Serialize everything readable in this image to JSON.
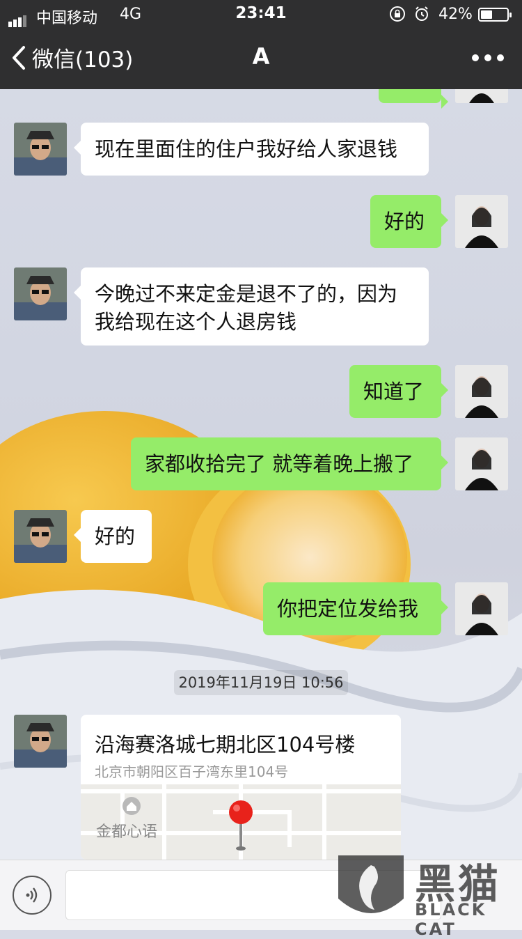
{
  "status_bar": {
    "carrier": "中国移动",
    "network": "4G",
    "time": "23:41",
    "battery_percent": "42%",
    "icons": [
      "signal-icon",
      "orientation-lock-icon",
      "alarm-icon",
      "battery-icon"
    ]
  },
  "nav": {
    "back_label": "微信(103)",
    "title": "A",
    "more_icon": "more-dots-icon"
  },
  "messages": [
    {
      "side": "left",
      "text": "现在里面住的住户我好给人家退钱"
    },
    {
      "side": "right",
      "text": "好的"
    },
    {
      "side": "left",
      "text_line1": "今晚过不来定金是退不了的，因为",
      "text_line2": "我给现在这个人退房钱"
    },
    {
      "side": "right",
      "text": "知道了"
    },
    {
      "side": "right",
      "text": "家都收拾完了 就等着晚上搬了"
    },
    {
      "side": "left",
      "text": "好的"
    },
    {
      "side": "right",
      "text": "你把定位发给我"
    }
  ],
  "timestamp": "2019年11月19日 10:56",
  "location": {
    "name": "沿海赛洛城七期北区104号楼",
    "address": "北京市朝阳区百子湾东里104号",
    "map_label": "金都心语",
    "icons": [
      "map-poi-icon",
      "map-pin-icon"
    ]
  },
  "input_bar": {
    "voice_icon": "voice-icon"
  },
  "watermark": {
    "text": "黑猫",
    "sub": "BLACK CAT"
  },
  "colors": {
    "nav_bg": "#2f2f30",
    "bubble_green": "#95ec69",
    "bubble_white": "#ffffff"
  }
}
